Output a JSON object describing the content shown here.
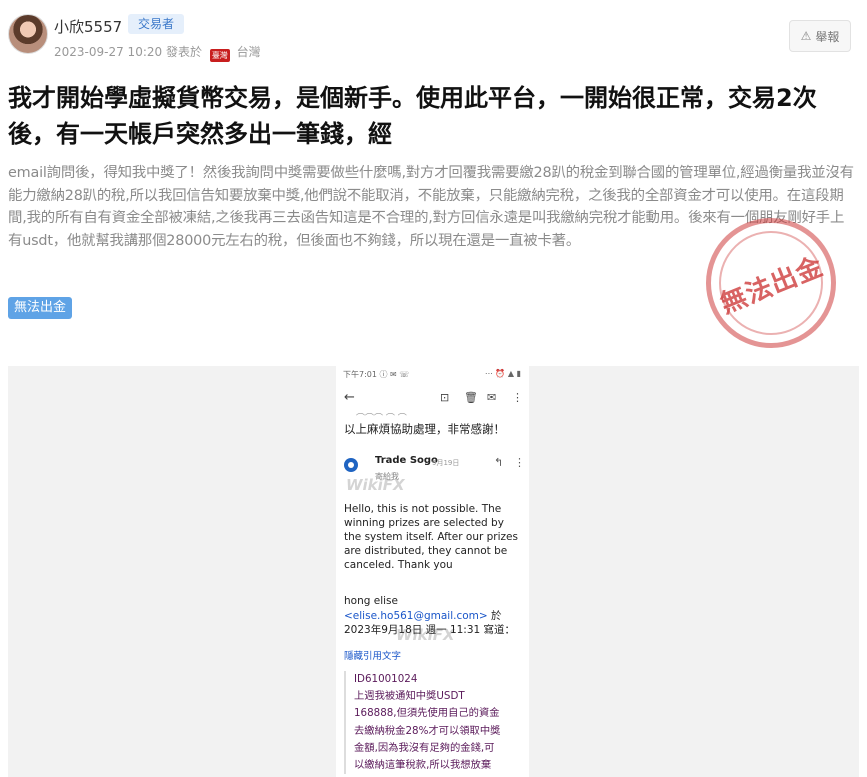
{
  "post": {
    "username": "小欣5557",
    "role_badge": "交易者",
    "date": "2023-09-27 10:20",
    "posted_from_label": "發表於",
    "flag_text": "臺灣",
    "location": "台灣",
    "report_label": "舉報",
    "title": "我才開始學虛擬貨幣交易，是個新手。使用此平台，一開始很正常，交易2次後，有一天帳戶突然多出一筆錢，經",
    "body": "email詢問後，得知我中獎了！然後我詢問中獎需要做些什麼嗎,對方才回覆我需要繳28趴的稅金到聯合國的管理單位,經過衡量我並沒有能力繳納28趴的稅,所以我回信告知要放棄中獎,他們說不能取消，不能放棄，只能繳納完稅，之後我的全部資金才可以使用。在這段期間,我的所有自有資金全部被凍結,之後我再三去函告知這是不合理的,對方回信永遠是叫我繳納完稅才能動用。後來有一個朋友剛好手上有usdt，他就幫我講那個28000元左右的稅，但後面也不夠錢，所以現在還是一直被卡著。",
    "tag": "無法出金",
    "stamp_text": "無法出金"
  },
  "screenshot": {
    "status_time": "下午7:01 ⓘ ✉ ☏",
    "status_signal": "⋯ ⏰ ▲ ▮",
    "thanks_line": "以上麻煩協助處理，非常感謝！",
    "sender_name": "Trade Sogo",
    "sender_date": "9月19日",
    "to_me": "寄給我",
    "watermark": "WikiFX",
    "mail_body": "Hello, this is not possible. The winning prizes are selected by the system itself. After our prizes are distributed, they cannot be canceled. Thank you",
    "quote_name": "hong elise",
    "quote_email": "<elise.ho561@gmail.com>",
    "quote_suffix": " 於",
    "quote_date": "2023年9月18日 週一 11:31 寫道：",
    "show_quote": "隱藏引用文字",
    "quote_lines": [
      "ID61001024",
      "上週我被通知中獎USDT",
      "168888,但須先使用自己的資金",
      "去繳納稅金28%才可以領取中獎",
      "金額,因為我沒有足夠的金錢,可",
      "以繳納這筆稅款,所以我想放棄"
    ]
  },
  "colors": {
    "badge_bg": "#e5effb",
    "badge_text": "#3a78c9",
    "tag_bg": "#5fa3e6",
    "stamp_red": "#cd3c3c",
    "link_blue": "#1a56c9"
  },
  "icons": [
    "warning-icon",
    "back-arrow-icon",
    "archive-icon",
    "delete-icon",
    "mail-icon",
    "more-vert-icon",
    "reply-icon",
    "sender-avatar-icon"
  ]
}
